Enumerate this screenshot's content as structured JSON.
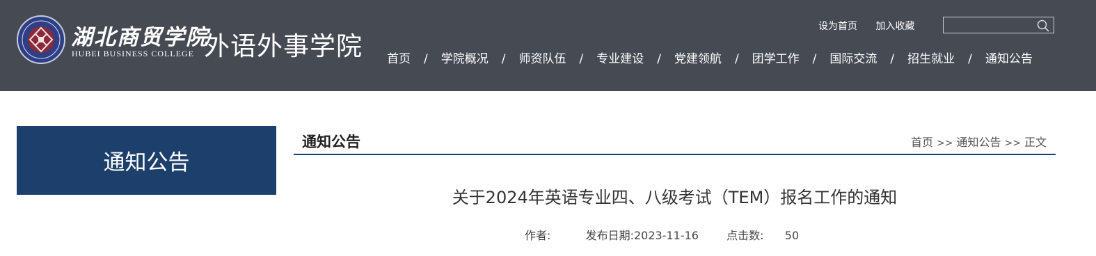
{
  "header": {
    "logo_cn": "湖北商贸学院",
    "logo_en": "HUBEI BUSINESS COLLEGE",
    "site_name": "外语外事学院",
    "top_links": [
      "设为首页",
      "加入收藏"
    ],
    "search_placeholder": ""
  },
  "nav": {
    "items": [
      "首页",
      "学院概况",
      "师资队伍",
      "专业建设",
      "党建领航",
      "团学工作",
      "国际交流",
      "招生就业",
      "通知公告"
    ],
    "separator": "/"
  },
  "sidebar": {
    "title": "通知公告"
  },
  "section": {
    "title": "通知公告",
    "breadcrumb": [
      "首页",
      "通知公告",
      "正文"
    ],
    "breadcrumb_sep": ">>"
  },
  "article": {
    "title": "关于2024年英语专业四、八级考试（TEM）报名工作的通知",
    "author_label": "作者:",
    "author": "",
    "date_label": "发布日期:",
    "date": "2023-11-16",
    "views_label": "点击数:",
    "views": "50"
  },
  "colors": {
    "header_bg": "#454a53",
    "accent": "#1d3f6b"
  },
  "icons": {
    "search": "search-icon"
  }
}
